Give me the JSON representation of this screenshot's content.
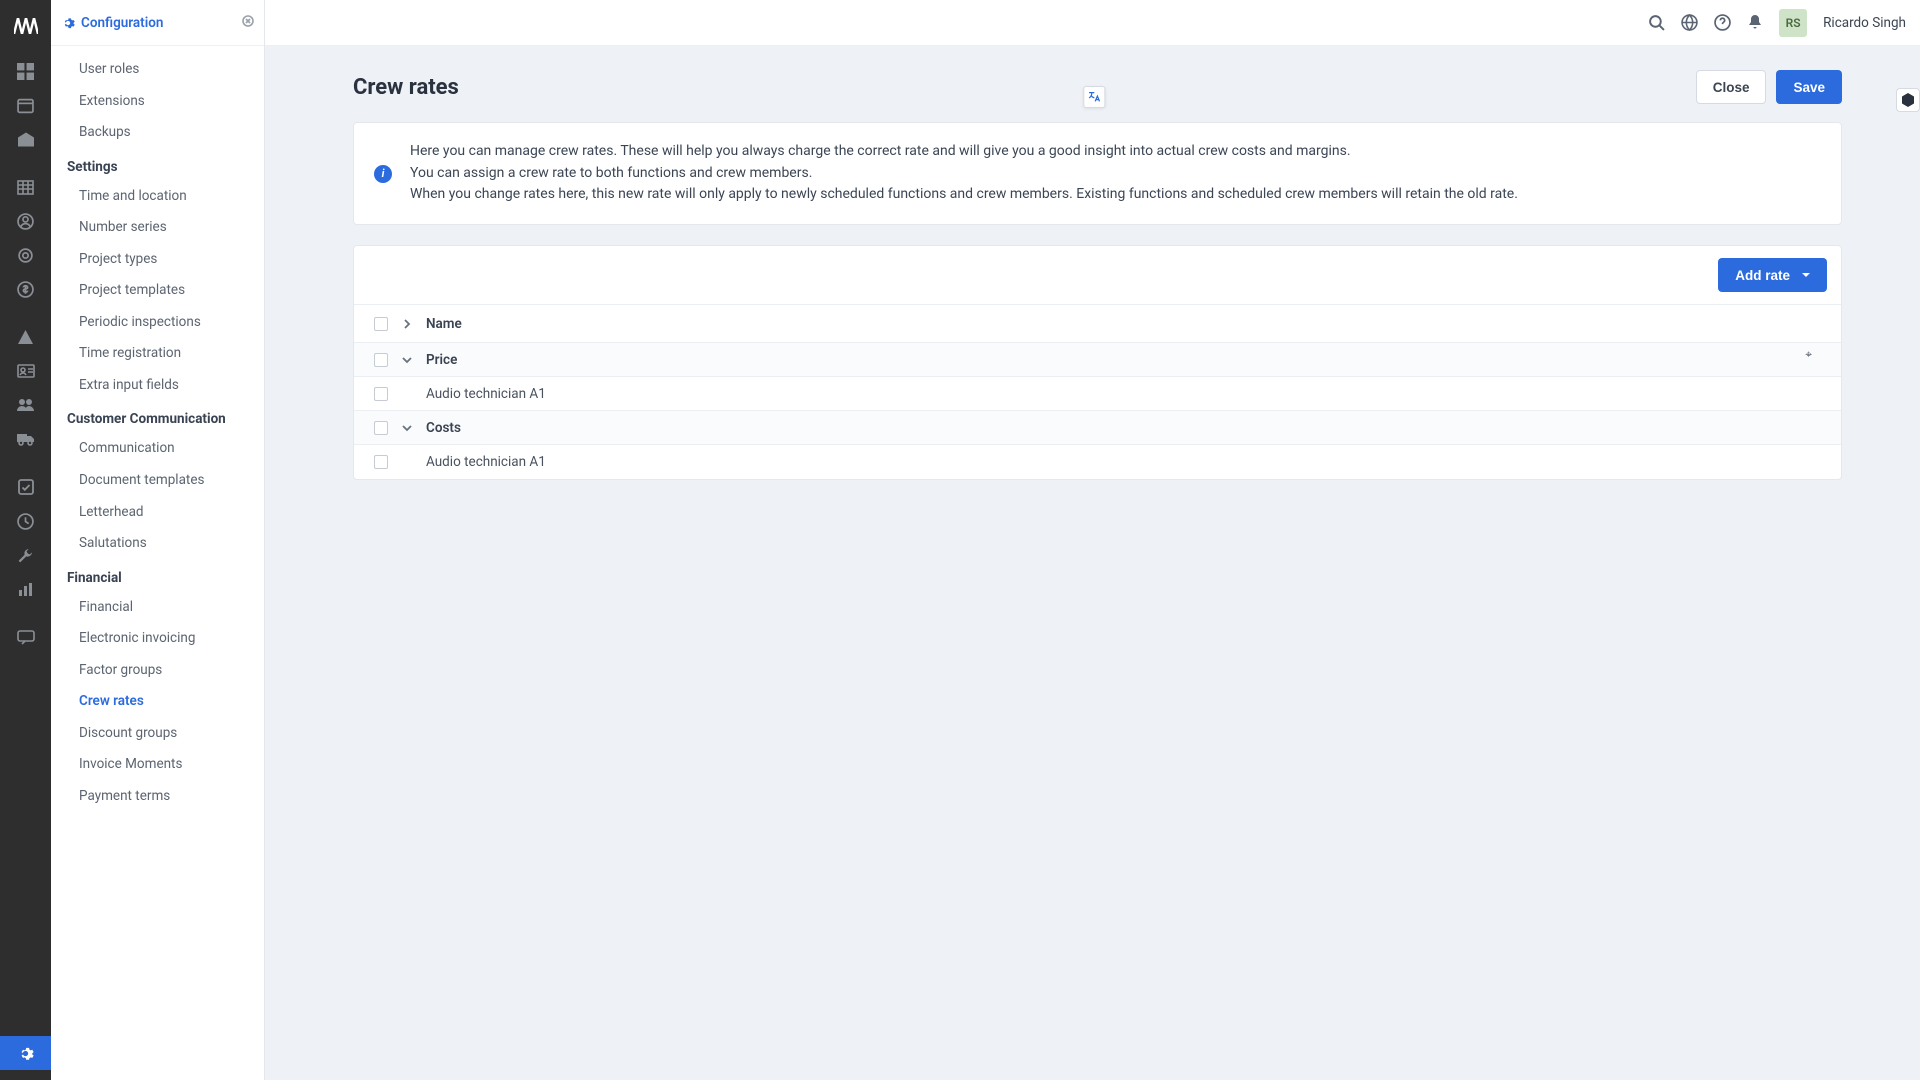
{
  "colors": {
    "accent": "#2b6bde",
    "rail": "#2e2e2e",
    "bg": "#eef1f6"
  },
  "tab": {
    "label": "Configuration"
  },
  "user": {
    "initials": "RS",
    "name": "Ricardo Singh"
  },
  "rail_icons": [
    "logo-icon",
    "dashboard-icon",
    "calendar-icon",
    "warehouse-icon",
    "table-icon",
    "user-circle-icon",
    "target-icon",
    "currency-icon",
    "alert-icon",
    "contact-card-icon",
    "people-icon",
    "truck-icon",
    "check-square-icon",
    "clock-icon",
    "wrench-icon",
    "chart-icon"
  ],
  "rail_chat_icon": "chat-icon",
  "rail_settings_icon": "gear-icon",
  "topbar_icons": [
    "search-icon",
    "globe-icon",
    "help-icon",
    "bell-icon"
  ],
  "sidebar": {
    "top_items": [
      "User roles",
      "Extensions",
      "Backups"
    ],
    "sections": [
      {
        "title": "Settings",
        "items": [
          "Time and location",
          "Number series",
          "Project types",
          "Project templates",
          "Periodic inspections",
          "Time registration",
          "Extra input fields"
        ]
      },
      {
        "title": "Customer Communication",
        "items": [
          "Communication",
          "Document templates",
          "Letterhead",
          "Salutations"
        ]
      },
      {
        "title": "Financial",
        "items": [
          "Financial",
          "Electronic invoicing",
          "Factor groups",
          "Crew rates",
          "Discount groups",
          "Invoice Moments",
          "Payment terms"
        ],
        "active": "Crew rates"
      }
    ]
  },
  "page": {
    "title": "Crew rates",
    "close": "Close",
    "save": "Save",
    "info": "Here you can manage crew rates. These will help you always charge the correct rate and will give you a good insight into actual crew costs and margins.\nYou can assign a crew rate to both functions and crew members.\nWhen you change rates here, this new rate will only apply to newly scheduled functions and crew members. Existing functions and scheduled crew members will retain the old rate.",
    "add_rate": "Add rate"
  },
  "table": {
    "header": "Name",
    "groups": [
      {
        "name": "Price",
        "rows": [
          "Audio technician A1"
        ]
      },
      {
        "name": "Costs",
        "rows": [
          "Audio technician A1"
        ]
      }
    ]
  }
}
